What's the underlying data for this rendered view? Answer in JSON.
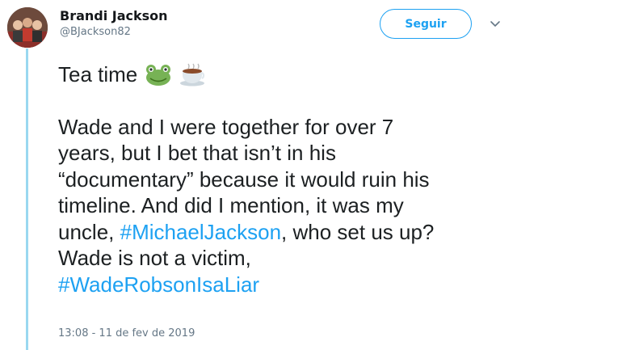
{
  "author": {
    "name": "Brandi Jackson",
    "handle": "@BJackson82"
  },
  "follow_button": {
    "label": "Seguir"
  },
  "tweet": {
    "intro": "Tea time",
    "emojis": [
      "frog-icon",
      "tea-cup-icon"
    ],
    "line1": "Wade and I were together for over 7",
    "line2": "years, but I bet that isn’t in his",
    "line3": "“documentary” because it would ruin his",
    "line4": "timeline.  And did I mention, it was my",
    "line5_pre": "uncle, ",
    "hashtag1": "#MichaelJackson",
    "line5_post": ", who set us up?",
    "line6": "Wade is not a victim,",
    "hashtag2": "#WadeRobsonIsaLiar",
    "timestamp": "13:08 - 11 de fev de 2019"
  },
  "colors": {
    "link": "#1da1f2",
    "thread_line": "#9ad8f0",
    "secondary_text": "#657786"
  }
}
